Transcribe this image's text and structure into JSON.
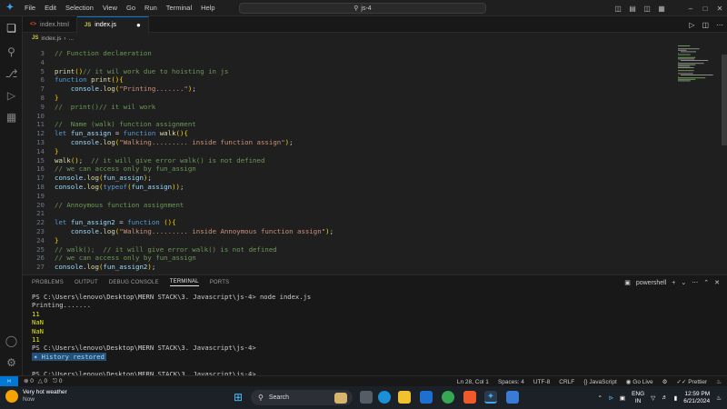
{
  "menu": [
    "File",
    "Edit",
    "Selection",
    "View",
    "Go",
    "Run",
    "Terminal",
    "Help"
  ],
  "command_center": "js-4",
  "tabs": [
    {
      "label": "index.html",
      "icon": "html-file-icon"
    },
    {
      "label": "index.js",
      "icon": "js-file-icon"
    }
  ],
  "breadcrumb": {
    "file": "index.js",
    "rest": "..."
  },
  "editor": {
    "lines": [
      {
        "n": "3",
        "t": "// Function declaeration"
      },
      {
        "n": "4",
        "t": ""
      },
      {
        "n": "5",
        "t": "print()// it wil work due to hoisting in js"
      },
      {
        "n": "6",
        "t": "function print(){"
      },
      {
        "n": "7",
        "t": "    console.log(\"Printing.......\");"
      },
      {
        "n": "8",
        "t": "}"
      },
      {
        "n": "9",
        "t": "//  print()// it wil work"
      },
      {
        "n": "10",
        "t": ""
      },
      {
        "n": "11",
        "t": "//  Name (walk) function assignment"
      },
      {
        "n": "12",
        "t": "let fun_assign = function walk(){"
      },
      {
        "n": "13",
        "t": "    console.log(\"Walking......... inside function assign\");"
      },
      {
        "n": "14",
        "t": "}"
      },
      {
        "n": "15",
        "t": "walk();  // it will give error walk() is not defined"
      },
      {
        "n": "16",
        "t": "// we can access only by fun_assign"
      },
      {
        "n": "17",
        "t": "console.log(fun_assign);"
      },
      {
        "n": "18",
        "t": "console.log(typeof(fun_assign));"
      },
      {
        "n": "19",
        "t": ""
      },
      {
        "n": "20",
        "t": "// Annoymous function assignment"
      },
      {
        "n": "21",
        "t": ""
      },
      {
        "n": "22",
        "t": "let fun_assign2 = function (){"
      },
      {
        "n": "23",
        "t": "    console.log(\"Walking......... inside Annoymous function assign\");"
      },
      {
        "n": "24",
        "t": "}"
      },
      {
        "n": "25",
        "t": "// walk();  // it will give error walk() is not defined"
      },
      {
        "n": "26",
        "t": "// we can access only by fun_assign"
      },
      {
        "n": "27",
        "t": "console.log(fun_assign2);"
      }
    ]
  },
  "panel": {
    "tabs": [
      "PROBLEMS",
      "OUTPUT",
      "DEBUG CONSOLE",
      "TERMINAL",
      "PORTS"
    ],
    "active_tab": "TERMINAL",
    "shell": "powershell"
  },
  "terminal": {
    "lines": [
      {
        "t": "PS C:\\Users\\lenovo\\Desktop\\MERN STACK\\3. Javascript\\js-4> node index.js",
        "c": "white"
      },
      {
        "t": "Printing.......",
        "c": "white"
      },
      {
        "t": "11",
        "c": "yellow"
      },
      {
        "t": "NaN",
        "c": "yellow"
      },
      {
        "t": "NaN",
        "c": "yellow"
      },
      {
        "t": "11",
        "c": "yellow"
      },
      {
        "t": "PS C:\\Users\\lenovo\\Desktop\\MERN STACK\\3. Javascript\\js-4>",
        "c": "white"
      },
      {
        "t": "History restored",
        "c": "restored"
      },
      {
        "t": "",
        "c": "white"
      },
      {
        "t": "PS C:\\Users\\lenovo\\Desktop\\MERN STACK\\3. Javascript\\js-4>",
        "c": "white"
      }
    ]
  },
  "status": {
    "errors": "0",
    "warnings": "0",
    "ports": "0",
    "position": "Ln 28, Col 1",
    "spaces": "Spaces: 4",
    "encoding": "UTF-8",
    "eol": "CRLF",
    "language": "JavaScript",
    "golive": "Go Live",
    "prettier": "Prettier"
  },
  "taskbar": {
    "weather_title": "Very hot weather",
    "weather_sub": "Now",
    "search_placeholder": "Search",
    "lang_top": "ENG",
    "lang_bottom": "IN",
    "time": "12:59 PM",
    "date": "6/21/2024"
  },
  "colors": {
    "accent": "#0078d4",
    "comment": "#6a9955",
    "keyword": "#569cd6",
    "function": "#dcdcaa",
    "string": "#ce9178",
    "terminal_yellow": "#e5e510"
  }
}
